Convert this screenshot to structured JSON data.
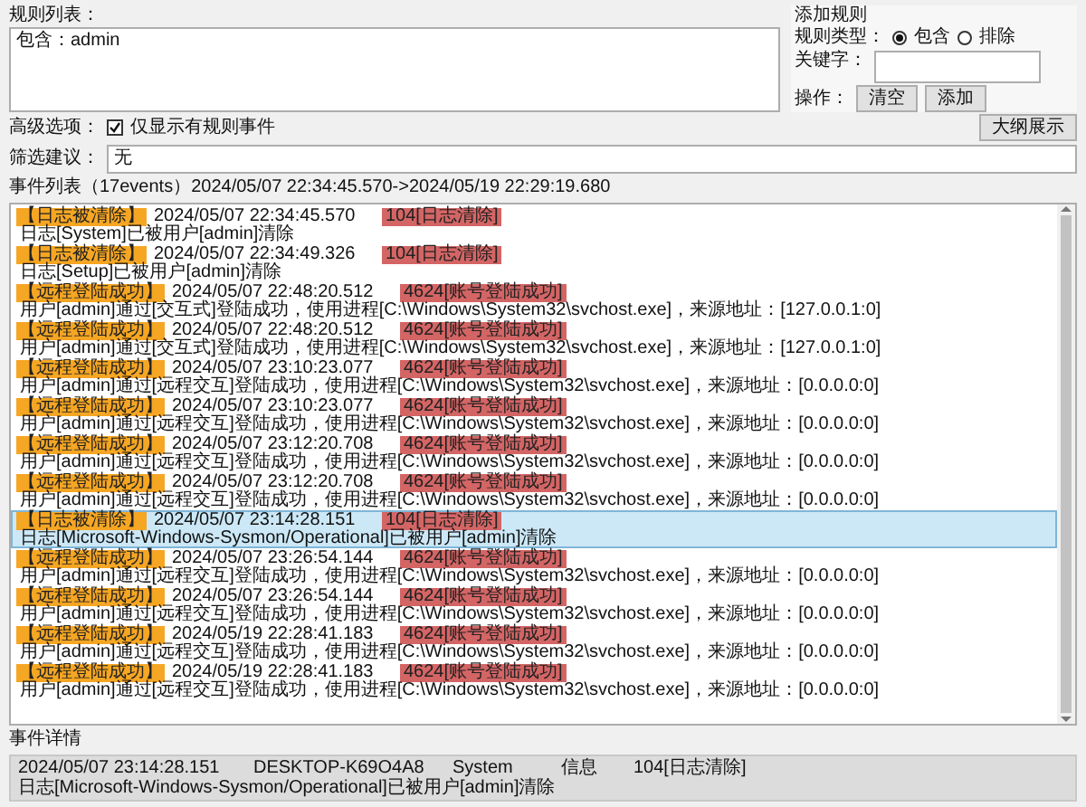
{
  "rules": {
    "label": "规则列表：",
    "items": [
      "包含：admin"
    ]
  },
  "add_rule": {
    "title": "添加规则",
    "type_label": "规则类型：",
    "types": [
      {
        "label": "包含",
        "selected": true
      },
      {
        "label": "排除",
        "selected": false
      }
    ],
    "keyword_label": "关键字：",
    "actions_label": "操作：",
    "buttons": [
      "清空",
      "添加"
    ]
  },
  "advanced": {
    "label": "高级选项：",
    "only_rule_events": {
      "label": "仅显示有规则事件",
      "checked": true
    },
    "outline_button": "大纲展示"
  },
  "suggestions": {
    "label": "筛选建议：",
    "text": "无"
  },
  "events": {
    "title": "事件列表（17events）2024/05/07 22:34:45.570->2024/05/19 22:29:19.680",
    "rows": [
      {
        "tag": "【日志被清除】",
        "time": "2024/05/07 22:34:45.570",
        "code": "104[日志清除]",
        "message": "日志[System]已被用户[admin]清除",
        "selected": false
      },
      {
        "tag": "【日志被清除】",
        "time": "2024/05/07 22:34:49.326",
        "code": "104[日志清除]",
        "message": "日志[Setup]已被用户[admin]清除",
        "selected": false
      },
      {
        "tag": "【远程登陆成功】",
        "time": "2024/05/07 22:48:20.512",
        "code": "4624[账号登陆成功]",
        "message": "用户[admin]通过[交互式]登陆成功，使用进程[C:\\Windows\\System32\\svchost.exe]，来源地址：[127.0.0.1:0]",
        "selected": false
      },
      {
        "tag": "【远程登陆成功】",
        "time": "2024/05/07 22:48:20.512",
        "code": "4624[账号登陆成功]",
        "message": "用户[admin]通过[交互式]登陆成功，使用进程[C:\\Windows\\System32\\svchost.exe]，来源地址：[127.0.0.1:0]",
        "selected": false
      },
      {
        "tag": "【远程登陆成功】",
        "time": "2024/05/07 23:10:23.077",
        "code": "4624[账号登陆成功]",
        "message": "用户[admin]通过[远程交互]登陆成功，使用进程[C:\\Windows\\System32\\svchost.exe]，来源地址：[0.0.0.0:0]",
        "selected": false
      },
      {
        "tag": "【远程登陆成功】",
        "time": "2024/05/07 23:10:23.077",
        "code": "4624[账号登陆成功]",
        "message": "用户[admin]通过[远程交互]登陆成功，使用进程[C:\\Windows\\System32\\svchost.exe]，来源地址：[0.0.0.0:0]",
        "selected": false
      },
      {
        "tag": "【远程登陆成功】",
        "time": "2024/05/07 23:12:20.708",
        "code": "4624[账号登陆成功]",
        "message": "用户[admin]通过[远程交互]登陆成功，使用进程[C:\\Windows\\System32\\svchost.exe]，来源地址：[0.0.0.0:0]",
        "selected": false
      },
      {
        "tag": "【远程登陆成功】",
        "time": "2024/05/07 23:12:20.708",
        "code": "4624[账号登陆成功]",
        "message": "用户[admin]通过[远程交互]登陆成功，使用进程[C:\\Windows\\System32\\svchost.exe]，来源地址：[0.0.0.0:0]",
        "selected": false
      },
      {
        "tag": "【日志被清除】",
        "time": "2024/05/07 23:14:28.151",
        "code": "104[日志清除]",
        "message": "日志[Microsoft-Windows-Sysmon/Operational]已被用户[admin]清除",
        "selected": true
      },
      {
        "tag": "【远程登陆成功】",
        "time": "2024/05/07 23:26:54.144",
        "code": "4624[账号登陆成功]",
        "message": "用户[admin]通过[远程交互]登陆成功，使用进程[C:\\Windows\\System32\\svchost.exe]，来源地址：[0.0.0.0:0]",
        "selected": false
      },
      {
        "tag": "【远程登陆成功】",
        "time": "2024/05/07 23:26:54.144",
        "code": "4624[账号登陆成功]",
        "message": "用户[admin]通过[远程交互]登陆成功，使用进程[C:\\Windows\\System32\\svchost.exe]，来源地址：[0.0.0.0:0]",
        "selected": false
      },
      {
        "tag": "【远程登陆成功】",
        "time": "2024/05/19 22:28:41.183",
        "code": "4624[账号登陆成功]",
        "message": "用户[admin]通过[远程交互]登陆成功，使用进程[C:\\Windows\\System32\\svchost.exe]，来源地址：[0.0.0.0:0]",
        "selected": false
      },
      {
        "tag": "【远程登陆成功】",
        "time": "2024/05/19 22:28:41.183",
        "code": "4624[账号登陆成功]",
        "message": "用户[admin]通过[远程交互]登陆成功，使用进程[C:\\Windows\\System32\\svchost.exe]，来源地址：[0.0.0.0:0]",
        "selected": false
      }
    ]
  },
  "details": {
    "label": "事件详情",
    "time": "2024/05/07 23:14:28.151",
    "computer": "DESKTOP-K69O4A8",
    "log": "System",
    "level": "信息",
    "code": "104[日志清除]",
    "message": "日志[Microsoft-Windows-Sysmon/Operational]已被用户[admin]清除"
  }
}
